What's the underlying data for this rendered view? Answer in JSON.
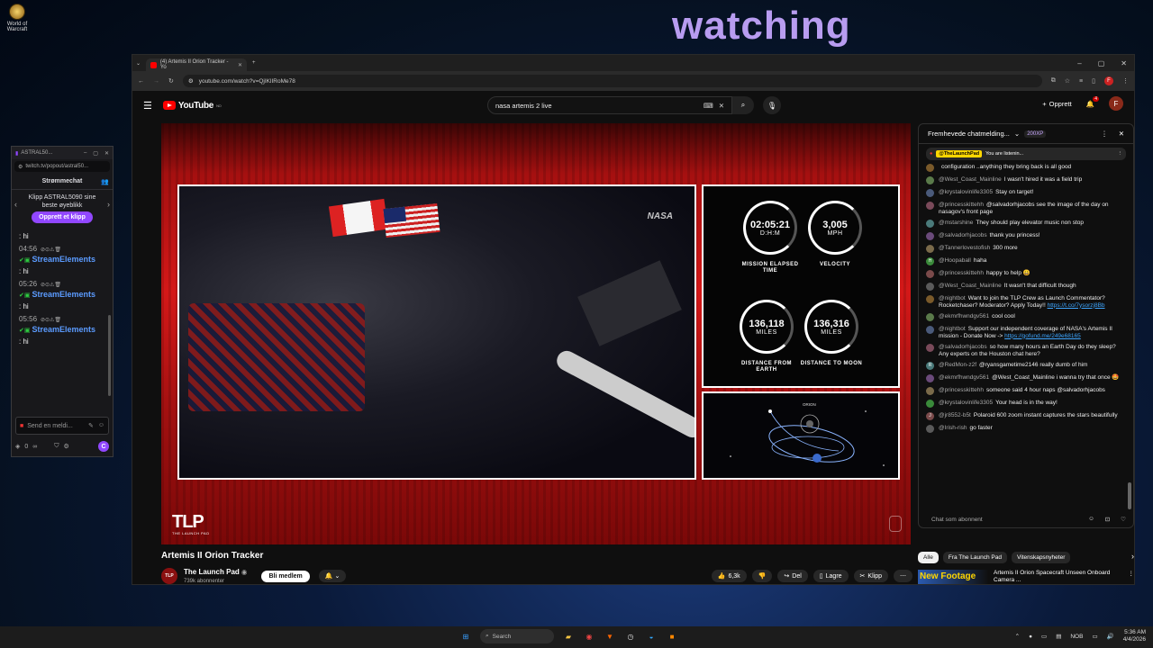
{
  "desktop": {
    "icon_label": "World of Warcraft",
    "overlay_text": "watching"
  },
  "twitch": {
    "window_title": "ASTRAL50...",
    "url": "twitch.tv/popout/astral50...",
    "header": "Strømmechat",
    "clip_prompt": "Klipp ASTRAL5090 sine beste øyeblikk",
    "clip_button": "Opprett et klipp",
    "first_text": ": hi",
    "messages": [
      {
        "time": "04:56",
        "user": "StreamElements",
        "text": ": hi"
      },
      {
        "time": "05:26",
        "user": "StreamElements",
        "text": ": hi"
      },
      {
        "time": "05:56",
        "user": "StreamElements",
        "text": ": hi"
      }
    ],
    "input_placeholder": "Send en meldi...",
    "points": "0",
    "chat_btn": "C"
  },
  "browser": {
    "tab_title": "(4) Artemis II Orion Tracker - Yo",
    "url": "youtube.com/watch?v=QjIKlIRoMe78",
    "profile_letter": "F"
  },
  "youtube": {
    "logo_text": "YouTube",
    "region": "NO",
    "search_value": "nasa artemis 2 live",
    "create_label": "Opprett",
    "notif_count": "4",
    "user_letter": "F"
  },
  "video": {
    "nasa_watermark": "NASA",
    "stats": [
      {
        "value": "02:05:21",
        "unit": "D:H:M",
        "label": "MISSION ELAPSED TIME"
      },
      {
        "value": "3,005",
        "unit": "MPH",
        "label": "VELOCITY"
      },
      {
        "value": "136,118",
        "unit": "MILES",
        "label": "DISTANCE FROM EARTH"
      },
      {
        "value": "136,316",
        "unit": "MILES",
        "label": "DISTANCE TO MOON"
      }
    ],
    "orbit_label": "ORION",
    "tlp_logo": "TLP",
    "tlp_sub": "THE LAUNCH PAD",
    "title": "Artemis II Orion Tracker",
    "channel_name": "The Launch Pad",
    "channel_avatar": "TLP",
    "subscribers": "739k abonnenter",
    "join_label": "Bli medlem",
    "likes": "6,3k",
    "share_label": "Del",
    "save_label": "Lagre",
    "clip_label": "Klipp"
  },
  "chat": {
    "header": "Fremhevede chatmelding...",
    "xp": "200XP",
    "pinned_user": "@TheLaunchPad",
    "pinned_text": "You are listenin...",
    "messages": [
      {
        "user": "",
        "text": "configuration ..anything they bring back is all good"
      },
      {
        "user": "@West_Coast_Mainline",
        "text": "I wasn't hired it was a field trip"
      },
      {
        "user": "@krystalovinlife3305",
        "text": "Stay on target!"
      },
      {
        "user": "@princesskittehh",
        "text": "@salvadorhjacobs see the image of the day on nasagov's front page"
      },
      {
        "user": "@mstarshine",
        "text": "They should play elevator music non stop"
      },
      {
        "user": "@salvadorhjacobs",
        "text": "thank you princess!"
      },
      {
        "user": "@Tannerlovestofish",
        "text": "300 more"
      },
      {
        "user": "@Hoopaball",
        "text": "haha"
      },
      {
        "user": "@princesskittehh",
        "text": "happy to help 😀"
      },
      {
        "user": "@West_Coast_Mainline",
        "text": "It wasn't that difficult though"
      },
      {
        "user": "@nightbot",
        "text": "Want to join the TLP Crew as Launch Commentator? Rocketchaser? Moderator? Apply Today!!",
        "link": "https://t.co/7ysorzj8Bb"
      },
      {
        "user": "@ekmrfhwndgv561",
        "text": "cool cool"
      },
      {
        "user": "@nightbot",
        "text": "Support our independent coverage of NASA's Artemis II mission - Donate Now ->",
        "link": "https://gofund.me/249e68165"
      },
      {
        "user": "@salvadorhjacobs",
        "text": "so how many hours an Earth Day do they sleep? Any experts on the Houston chat here?"
      },
      {
        "user": "@RedMon-z2f",
        "text": "@ryansgametime2146 really dumb of him"
      },
      {
        "user": "@ekmrfhwndgv561",
        "text": "@West_Coast_Mainline i wanna try that once 🤩"
      },
      {
        "user": "@princesskittehh",
        "text": "someone said 4 hour naps @salvadorhjacobs"
      },
      {
        "user": "@krystalovinlife3305",
        "text": "Your head is in the way!"
      },
      {
        "user": "@jr8552-b5t",
        "text": "Polaroid 600 zoom instant captures the stars beautifully"
      },
      {
        "user": "@Irish-rish",
        "text": "go faster"
      }
    ],
    "avatar_letters": [
      "",
      "",
      "",
      "",
      "",
      "",
      "",
      "H",
      "",
      "",
      "",
      "",
      "",
      "",
      "R",
      "",
      "",
      "",
      "J",
      ""
    ],
    "input_placeholder": "Chat som abonnent",
    "chips": [
      "Alle",
      "Fra The Launch Pad",
      "Vitenskapsnyheter"
    ],
    "next_thumb": "New Footage",
    "next_title": "Artemis II Orion Spacecraft Unseen Onboard Camera ..."
  },
  "taskbar": {
    "search": "Search",
    "lang": "NOB",
    "time": "5:36 AM",
    "date": "4/4/2026"
  }
}
